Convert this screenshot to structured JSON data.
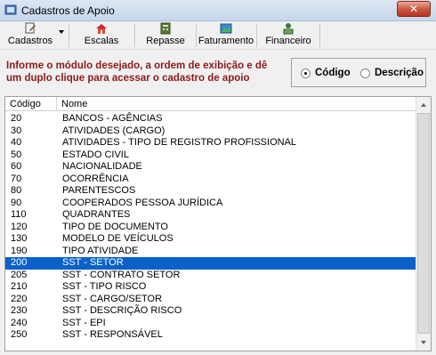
{
  "window": {
    "title": "Cadastros de Apoio",
    "close_glyph": "✕"
  },
  "toolbar": {
    "buttons": [
      {
        "label": "Cadastros",
        "icon": "cadastros-icon"
      },
      {
        "label": "Escalas",
        "icon": "escalas-icon"
      },
      {
        "label": "Repasse",
        "icon": "repasse-icon"
      },
      {
        "label": "Faturamento",
        "icon": "faturamento-icon"
      },
      {
        "label": "Financeiro",
        "icon": "financeiro-icon"
      }
    ]
  },
  "instruction": "Informe o módulo desejado, a ordem de exibição e dê um duplo clique para acessar o cadastro de apoio",
  "sort": {
    "options": [
      {
        "label": "Código",
        "checked": true
      },
      {
        "label": "Descrição",
        "checked": false
      }
    ]
  },
  "list": {
    "columns": [
      "Código",
      "Nome"
    ],
    "rows": [
      {
        "code": "20",
        "name": "BANCOS - AGÊNCIAS"
      },
      {
        "code": "30",
        "name": "ATIVIDADES (CARGO)"
      },
      {
        "code": "40",
        "name": "ATIVIDADES - TIPO DE REGISTRO PROFISSIONAL"
      },
      {
        "code": "50",
        "name": "ESTADO CIVIL"
      },
      {
        "code": "60",
        "name": "NACIONALIDADE"
      },
      {
        "code": "70",
        "name": "OCORRÊNCIA"
      },
      {
        "code": "80",
        "name": "PARENTESCOS"
      },
      {
        "code": "90",
        "name": "COOPERADOS PESSOA JURÍDICA"
      },
      {
        "code": "110",
        "name": "QUADRANTES"
      },
      {
        "code": "120",
        "name": "TIPO DE DOCUMENTO"
      },
      {
        "code": "130",
        "name": "MODELO DE VEÍCULOS"
      },
      {
        "code": "190",
        "name": "TIPO ATIVIDADE"
      },
      {
        "code": "200",
        "name": "SST - SETOR",
        "selected": true
      },
      {
        "code": "205",
        "name": "SST - CONTRATO SETOR"
      },
      {
        "code": "210",
        "name": "SST - TIPO RISCO"
      },
      {
        "code": "220",
        "name": "SST - CARGO/SETOR"
      },
      {
        "code": "230",
        "name": "SST - DESCRIÇÃO RISCO"
      },
      {
        "code": "240",
        "name": "SST - EPI"
      },
      {
        "code": "250",
        "name": "SST - RESPONSÁVEL"
      }
    ]
  },
  "colors": {
    "selection": "#0a62c8",
    "instruction_text": "#8b1a1a"
  }
}
